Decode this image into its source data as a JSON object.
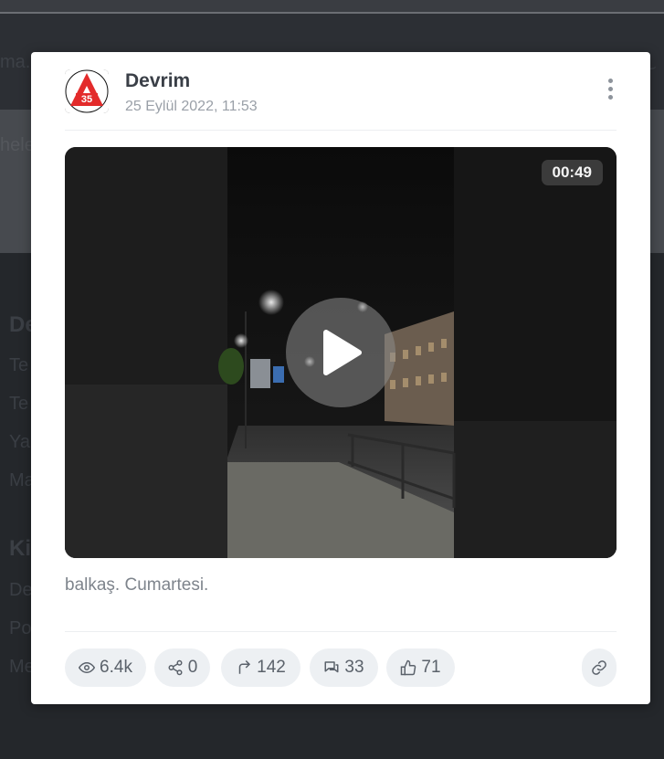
{
  "background": {
    "header_text": "ma.",
    "band_text": "hele",
    "section1_title": "De",
    "section1_items": [
      "Te",
      "Te",
      "Ya",
      "Ma"
    ],
    "section2_title": "Ki",
    "section2_items": [
      "De",
      "Po",
      "Me"
    ]
  },
  "post": {
    "author": "Devrim",
    "avatar_text": "35",
    "date": "25 Eylül 2022, 11:53",
    "video": {
      "duration": "00:49"
    },
    "caption": "balkaş. Cumartesi.",
    "stats": {
      "views": "6.4k",
      "shares": "0",
      "forwards": "142",
      "comments": "33",
      "likes": "71"
    }
  },
  "colors": {
    "accent_red": "#e32b2b",
    "card_bg": "#ffffff",
    "chip_bg": "#edf0f3"
  },
  "icons": {
    "more": "vertical-dots-icon",
    "play": "play-icon",
    "views": "eye-icon",
    "shares": "share-icon",
    "forwards": "forward-arrow-icon",
    "comments": "comments-icon",
    "likes": "thumbs-up-icon",
    "link": "link-icon"
  }
}
